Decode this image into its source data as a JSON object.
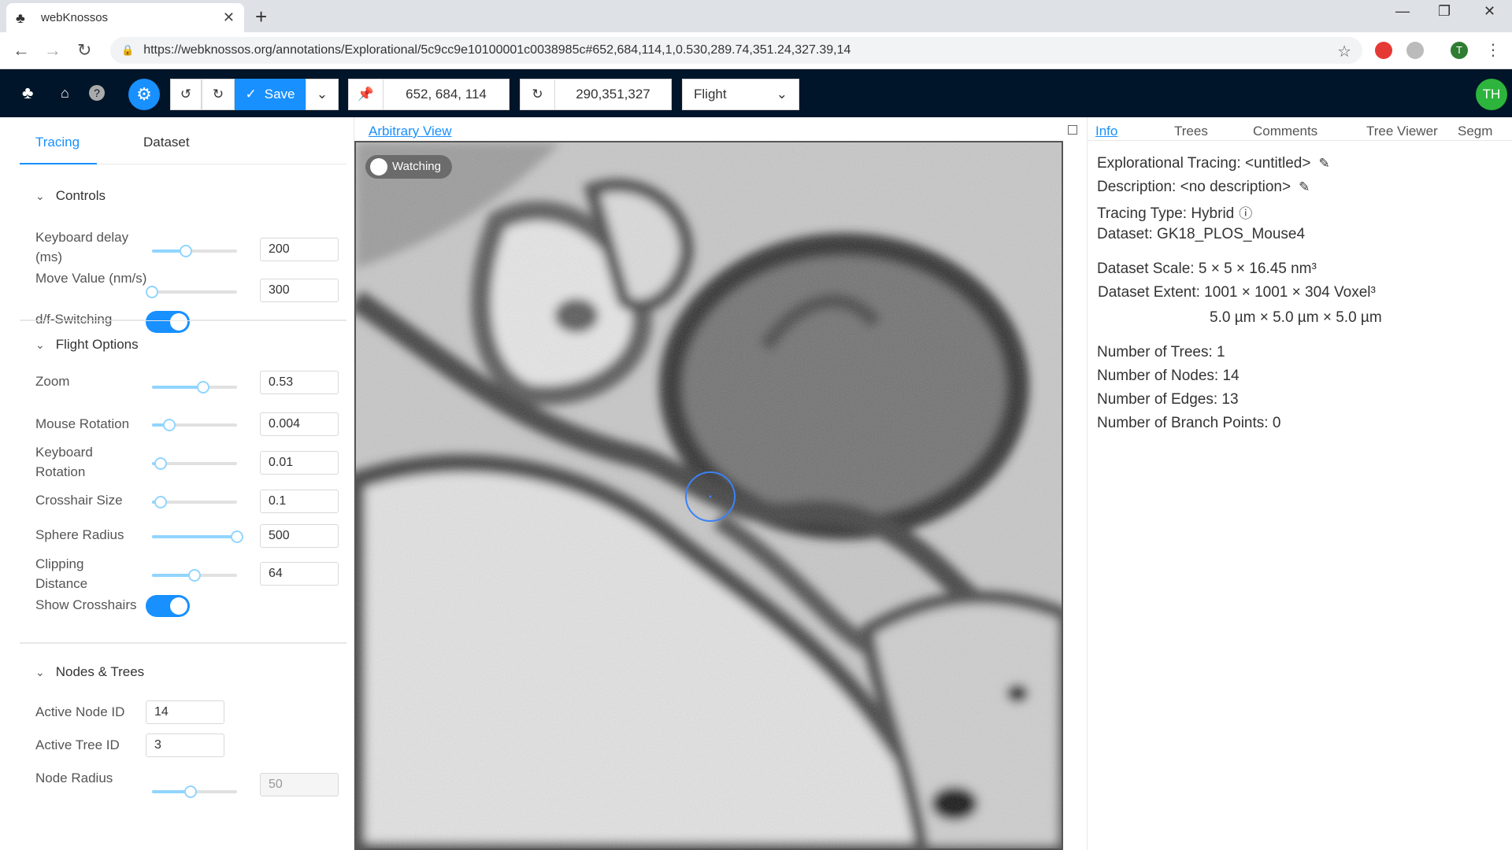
{
  "browser": {
    "tab_title": "webKnossos",
    "url": "https://webknossos.org/annotations/Explorational/5c9cc9e10100001c0038985c#652,684,114,1,0.530,289.74,351.24,327.39,14",
    "profile_initial": "T"
  },
  "toolbar": {
    "save_label": "Save",
    "position": "652, 684, 114",
    "rotation": "290,351,327",
    "mode": "Flight",
    "user_initials": "TH"
  },
  "left": {
    "tabs": [
      "Tracing",
      "Dataset"
    ],
    "controls": {
      "title": "Controls",
      "keyboard_delay_label": "Keyboard delay (ms)",
      "keyboard_delay_value": "200",
      "move_value_label": "Move Value (nm/s)",
      "move_value_value": "300",
      "df_switching_label": "d/f-Switching"
    },
    "flight": {
      "title": "Flight Options",
      "zoom_label": "Zoom",
      "zoom_value": "0.53",
      "mouse_rotation_label": "Mouse Rotation",
      "mouse_rotation_value": "0.004",
      "keyboard_rotation_label": "Keyboard Rotation",
      "keyboard_rotation_value": "0.01",
      "crosshair_size_label": "Crosshair Size",
      "crosshair_size_value": "0.1",
      "sphere_radius_label": "Sphere Radius",
      "sphere_radius_value": "500",
      "clipping_distance_label": "Clipping Distance",
      "clipping_distance_value": "64",
      "show_crosshairs_label": "Show Crosshairs"
    },
    "nodes": {
      "title": "Nodes & Trees",
      "active_node_label": "Active Node ID",
      "active_node_value": "14",
      "active_tree_label": "Active Tree ID",
      "active_tree_value": "3",
      "node_radius_label": "Node Radius",
      "node_radius_value": "50"
    }
  },
  "center": {
    "view_title": "Arbitrary View",
    "watching_label": "Watching"
  },
  "right": {
    "tabs": [
      "Info",
      "Trees",
      "Comments",
      "Tree Viewer",
      "Segm"
    ],
    "tracing_name": "Explorational Tracing:  <untitled>",
    "description": "Description:  <no description>",
    "tracing_type": "Tracing Type: Hybrid",
    "dataset": "Dataset: GK18_PLOS_Mouse4",
    "scale": "Dataset Scale: 5 × 5 × 16.45 nm³",
    "extent_voxel": "Dataset Extent:  1001 × 1001 × 304 Voxel³",
    "extent_um": "5.0 µm × 5.0 µm × 5.0 µm",
    "num_trees": "Number of Trees: 1",
    "num_nodes": "Number of Nodes: 14",
    "num_edges": "Number of Edges: 13",
    "num_branch": "Number of Branch Points: 0"
  },
  "colors": {
    "accent": "#1890ff",
    "toolbar_bg": "#001529",
    "avatar": "#2db43c"
  },
  "sliders": {
    "keyboard_delay": 0.4,
    "move_value": 0.0,
    "zoom": 0.6,
    "mouse_rotation": 0.2,
    "keyboard_rotation": 0.1,
    "crosshair_size": 0.1,
    "sphere_radius": 1.0,
    "clipping_distance": 0.5,
    "node_radius": 0.45
  }
}
